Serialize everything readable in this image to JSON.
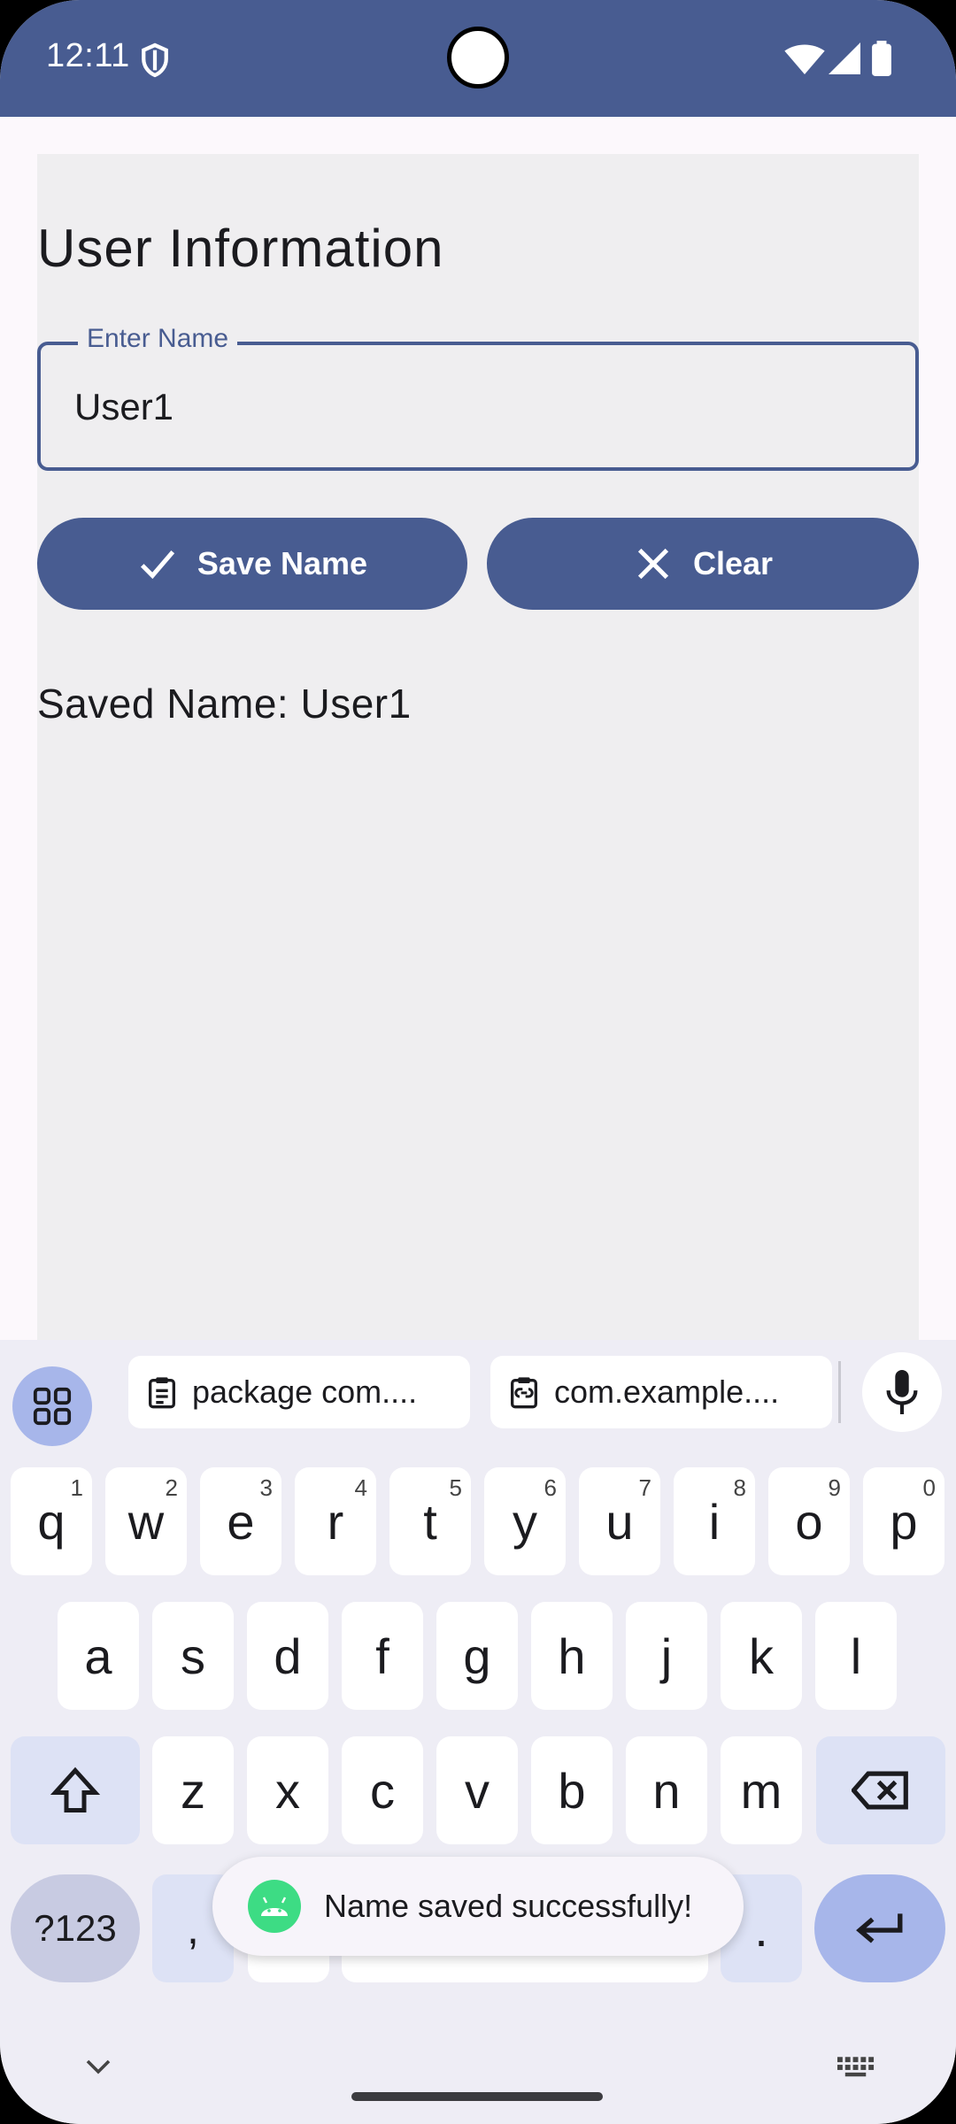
{
  "status_bar": {
    "time": "12:11"
  },
  "page": {
    "title": "User Information"
  },
  "name_field": {
    "label": "Enter Name",
    "value": "User1"
  },
  "buttons": {
    "save": "Save Name",
    "clear": "Clear"
  },
  "saved_text": "Saved Name: User1",
  "keyboard": {
    "clipboard_chips": [
      "package com....",
      "com.example...."
    ],
    "row1": [
      {
        "k": "q",
        "n": "1"
      },
      {
        "k": "w",
        "n": "2"
      },
      {
        "k": "e",
        "n": "3"
      },
      {
        "k": "r",
        "n": "4"
      },
      {
        "k": "t",
        "n": "5"
      },
      {
        "k": "y",
        "n": "6"
      },
      {
        "k": "u",
        "n": "7"
      },
      {
        "k": "i",
        "n": "8"
      },
      {
        "k": "o",
        "n": "9"
      },
      {
        "k": "p",
        "n": "0"
      }
    ],
    "row2": [
      "a",
      "s",
      "d",
      "f",
      "g",
      "h",
      "j",
      "k",
      "l"
    ],
    "row3": [
      "z",
      "x",
      "c",
      "v",
      "b",
      "n",
      "m"
    ],
    "symbols_key": "?123",
    "comma_key": ",",
    "period_key": "."
  },
  "toast": {
    "message": "Name saved successfully!"
  },
  "colors": {
    "primary": "#485c91",
    "surface": "#efeef0",
    "keyboard_bg": "#eeedf5",
    "accent_key": "#a7b6ea"
  }
}
